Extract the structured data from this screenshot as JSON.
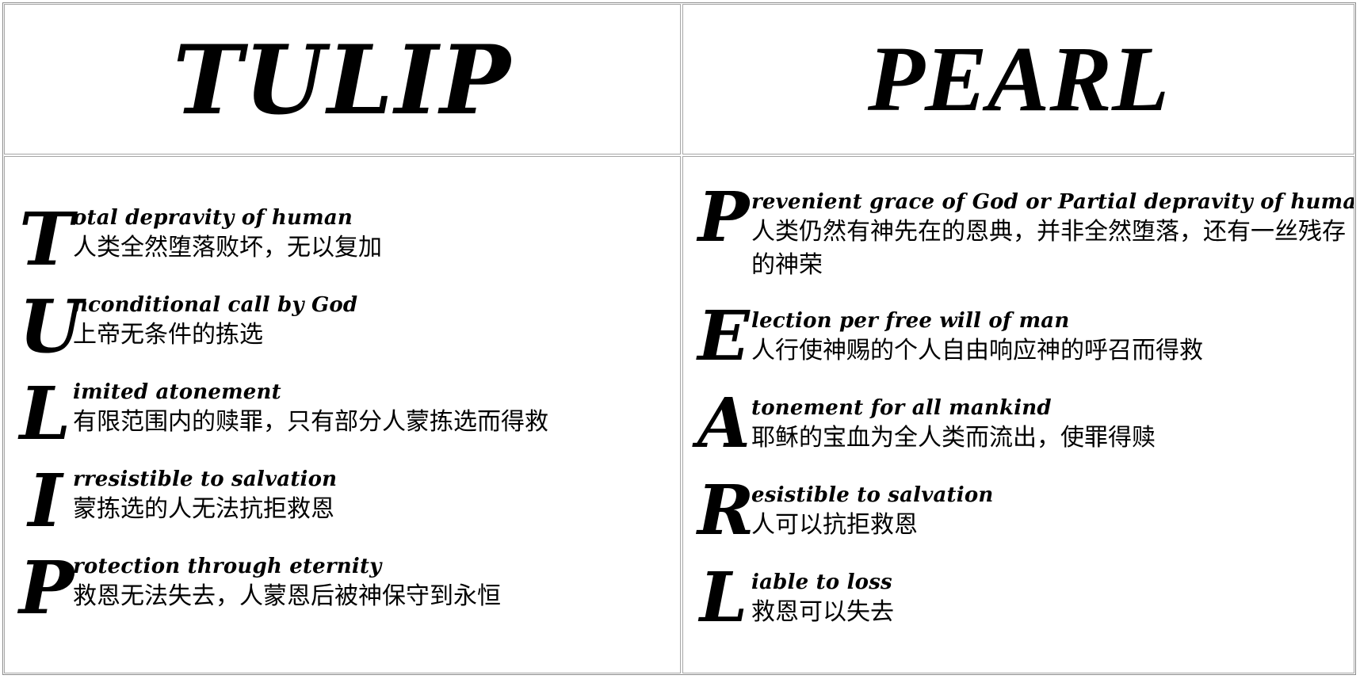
{
  "tulip": {
    "title": "TULIP",
    "items": [
      {
        "initial": "T",
        "english": "otal depravity of human",
        "chinese": "人类全然堕落败坏，无以复加"
      },
      {
        "initial": "U",
        "english": "nconditional call by God",
        "chinese": "上帝无条件的拣选"
      },
      {
        "initial": "L",
        "english": "imited atonement",
        "chinese": "有限范围内的赎罪，只有部分人蒙拣选而得救"
      },
      {
        "initial": "I",
        "english": "rresistible to salvation",
        "chinese": "蒙拣选的人无法抗拒救恩"
      },
      {
        "initial": "P",
        "english": "rotection through eternity",
        "chinese": "救恩无法失去，人蒙恩后被神保守到永恒"
      }
    ]
  },
  "pearl": {
    "title": "PEARL",
    "items": [
      {
        "initial": "P",
        "english": "revenient grace of God or Partial depravity of human",
        "chinese": "人类仍然有神先在的恩典，并非全然堕落，还有一丝残存的神荣"
      },
      {
        "initial": "E",
        "english": "lection per free will of man",
        "chinese": "人行使神赐的个人自由响应神的呼召而得救"
      },
      {
        "initial": "A",
        "english": "tonement for all mankind",
        "chinese": "耶稣的宝血为全人类而流出，使罪得赎"
      },
      {
        "initial": "R",
        "english": "esistible to salvation",
        "chinese": "人可以抗拒救恩"
      },
      {
        "initial": "L",
        "english": "iable to loss",
        "chinese": "救恩可以失去"
      }
    ]
  }
}
